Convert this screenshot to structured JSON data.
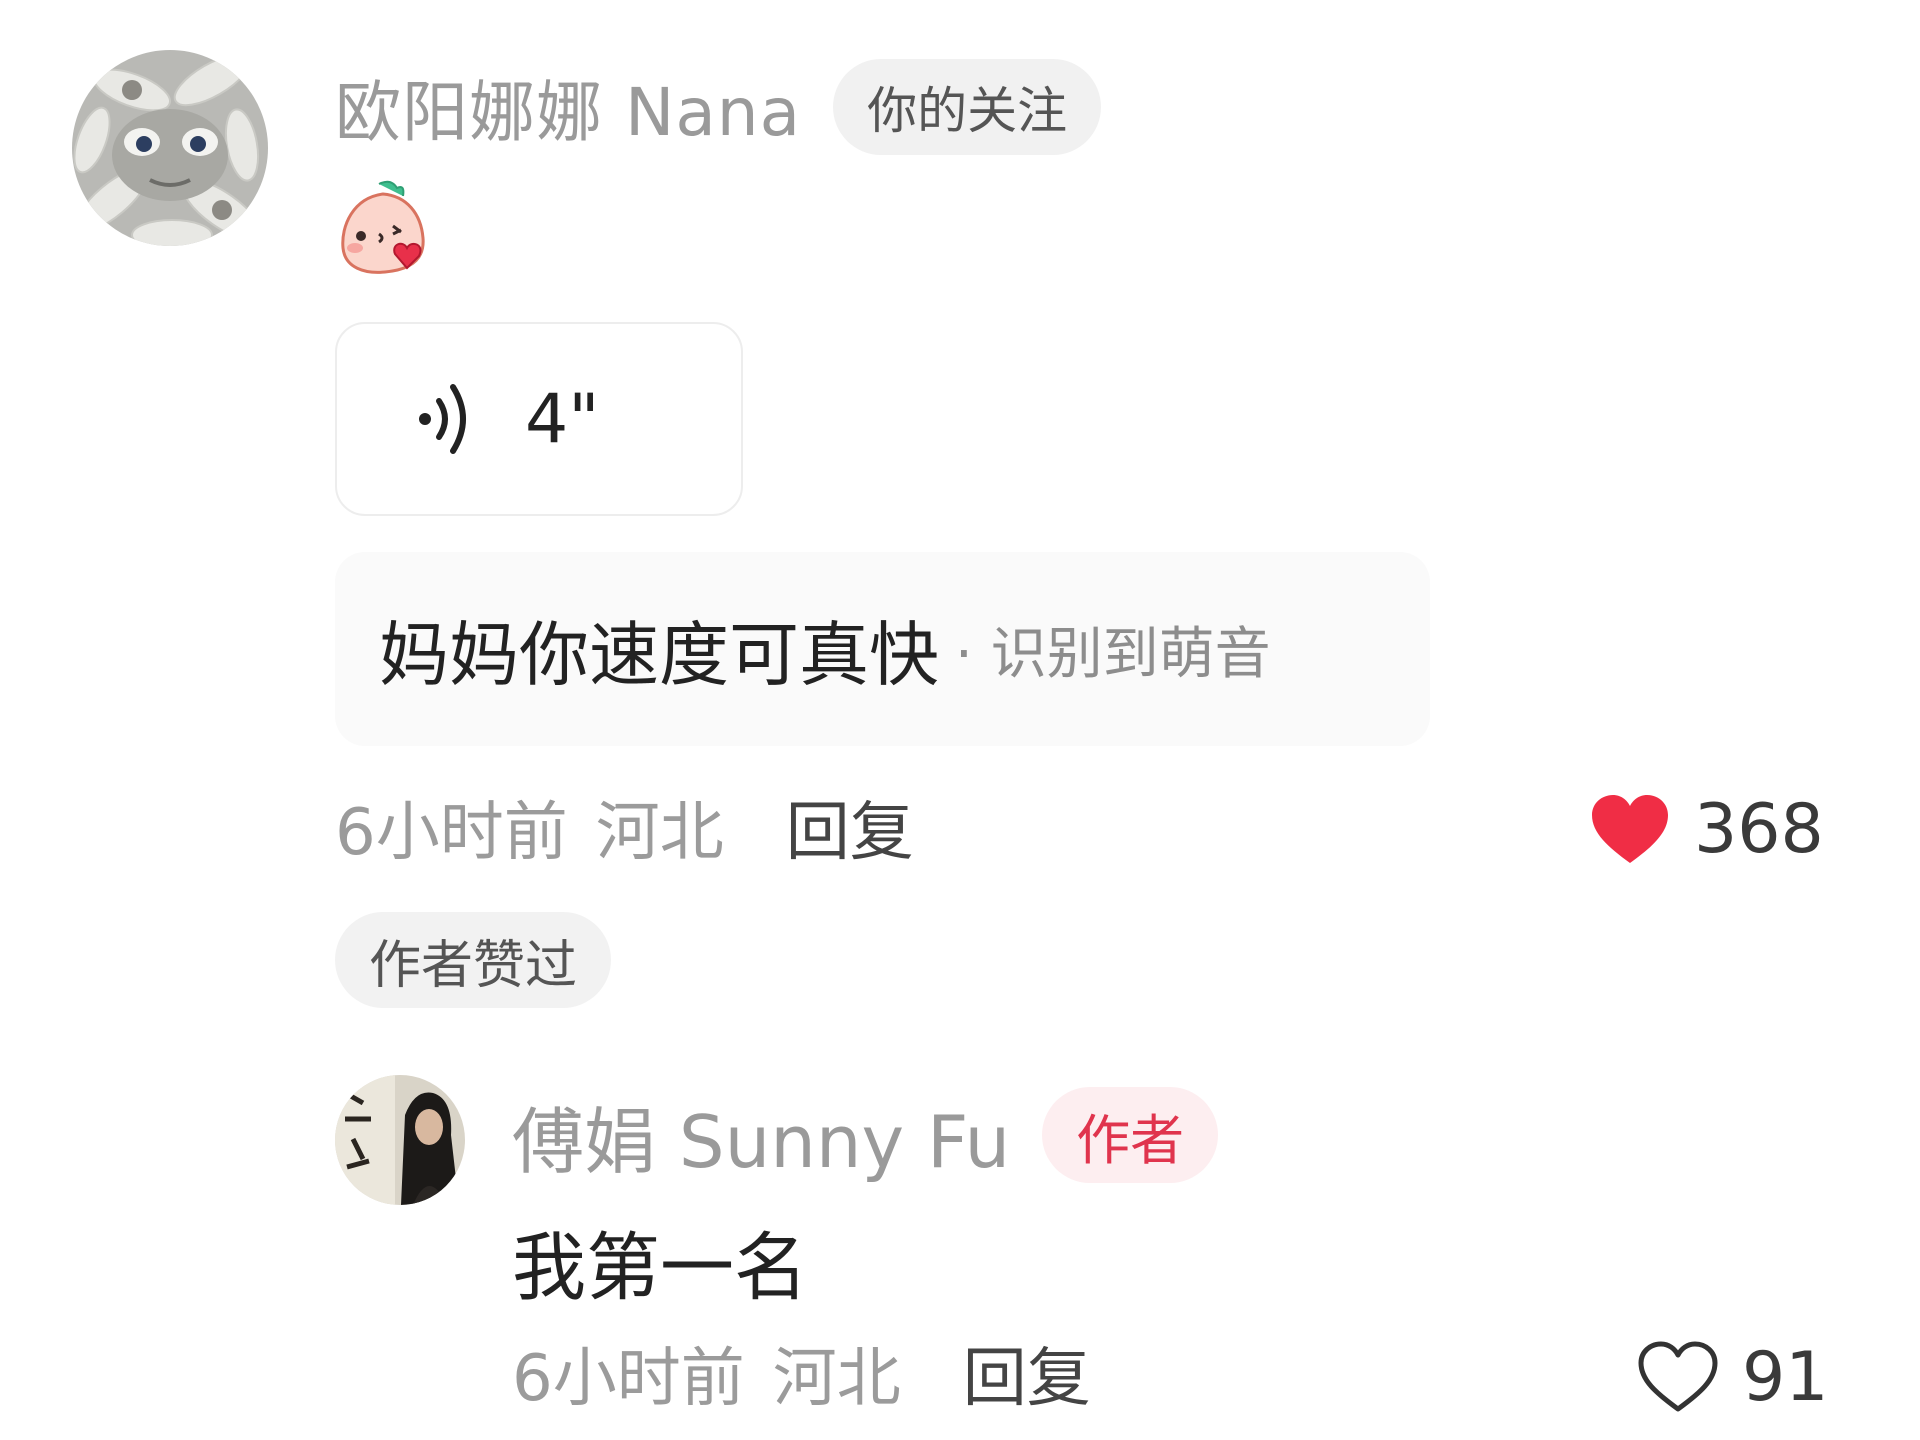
{
  "comment": {
    "username": "欧阳娜娜 Nana",
    "follow_badge": "你的关注",
    "sticker": "kissing-peach-sticker",
    "voice": {
      "duration": "4\""
    },
    "transcript": {
      "text": "妈妈你速度可真快",
      "note": "· 识别到萌音"
    },
    "meta": {
      "time": "6小时前",
      "region": "河北",
      "reply_label": "回复"
    },
    "likes": {
      "count": "368",
      "liked": true,
      "color": "#f02d45"
    },
    "author_liked_badge": "作者赞过"
  },
  "reply": {
    "username": "傅娟 Sunny Fu",
    "author_badge": "作者",
    "text": "我第一名",
    "meta": {
      "time": "6小时前",
      "region": "河北",
      "reply_label": "回复"
    },
    "likes": {
      "count": "91",
      "liked": false
    }
  },
  "colors": {
    "author_badge_text": "#e0344d",
    "author_badge_bg": "#fdeef0",
    "muted_text": "#9b9b9b"
  }
}
